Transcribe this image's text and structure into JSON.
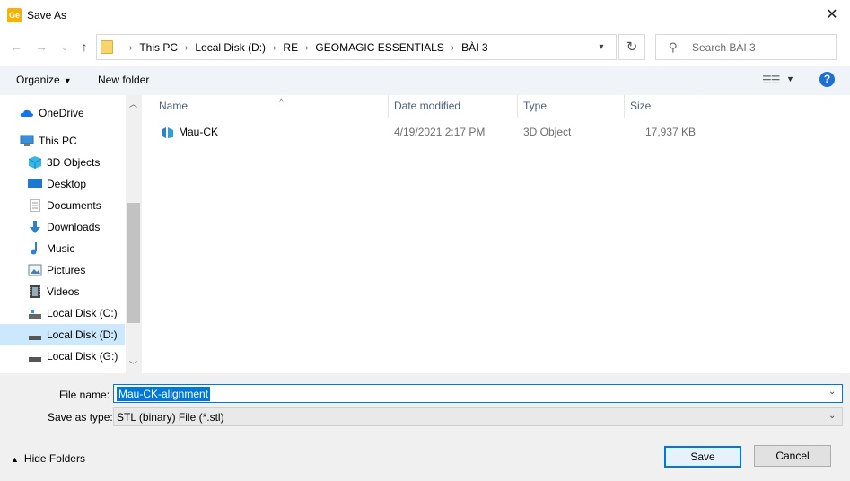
{
  "window": {
    "title": "Save As",
    "app_icon_text": "Ge"
  },
  "address": {
    "crumbs": [
      "This PC",
      "Local Disk (D:)",
      "RE",
      "GEOMAGIC ESSENTIALS",
      "BÀI 3"
    ]
  },
  "search": {
    "placeholder": "Search BÀI 3"
  },
  "toolbar": {
    "organize_label": "Organize",
    "new_folder_label": "New folder"
  },
  "sidebar": {
    "items": [
      {
        "label": "OneDrive",
        "icon": "cloud-icon"
      },
      {
        "label": "This PC",
        "icon": "computer-icon"
      },
      {
        "label": "3D Objects",
        "icon": "cube-icon"
      },
      {
        "label": "Desktop",
        "icon": "desktop-icon"
      },
      {
        "label": "Documents",
        "icon": "document-icon"
      },
      {
        "label": "Downloads",
        "icon": "download-icon"
      },
      {
        "label": "Music",
        "icon": "music-icon"
      },
      {
        "label": "Pictures",
        "icon": "picture-icon"
      },
      {
        "label": "Videos",
        "icon": "video-icon"
      },
      {
        "label": "Local Disk (C:)",
        "icon": "drive-icon"
      },
      {
        "label": "Local Disk (D:)",
        "icon": "drive-icon",
        "selected": true
      },
      {
        "label": "Local Disk (G:)",
        "icon": "drive-icon"
      }
    ]
  },
  "filelist": {
    "columns": [
      "Name",
      "Date modified",
      "Type",
      "Size"
    ],
    "rows": [
      {
        "name": "Mau-CK",
        "date": "4/19/2021 2:17 PM",
        "type": "3D Object",
        "size": "17,937 KB"
      }
    ]
  },
  "form": {
    "filename_label": "File name:",
    "filename_value": "Mau-CK-alignment",
    "savetype_label": "Save as type:",
    "savetype_value": "STL (binary) File (*.stl)"
  },
  "footer": {
    "hide_folders_label": "Hide Folders",
    "save_label": "Save",
    "cancel_label": "Cancel"
  },
  "colors": {
    "accent": "#0078d7",
    "selected_bg": "#cce8ff",
    "toolbar_bg": "#f0f4f9"
  }
}
